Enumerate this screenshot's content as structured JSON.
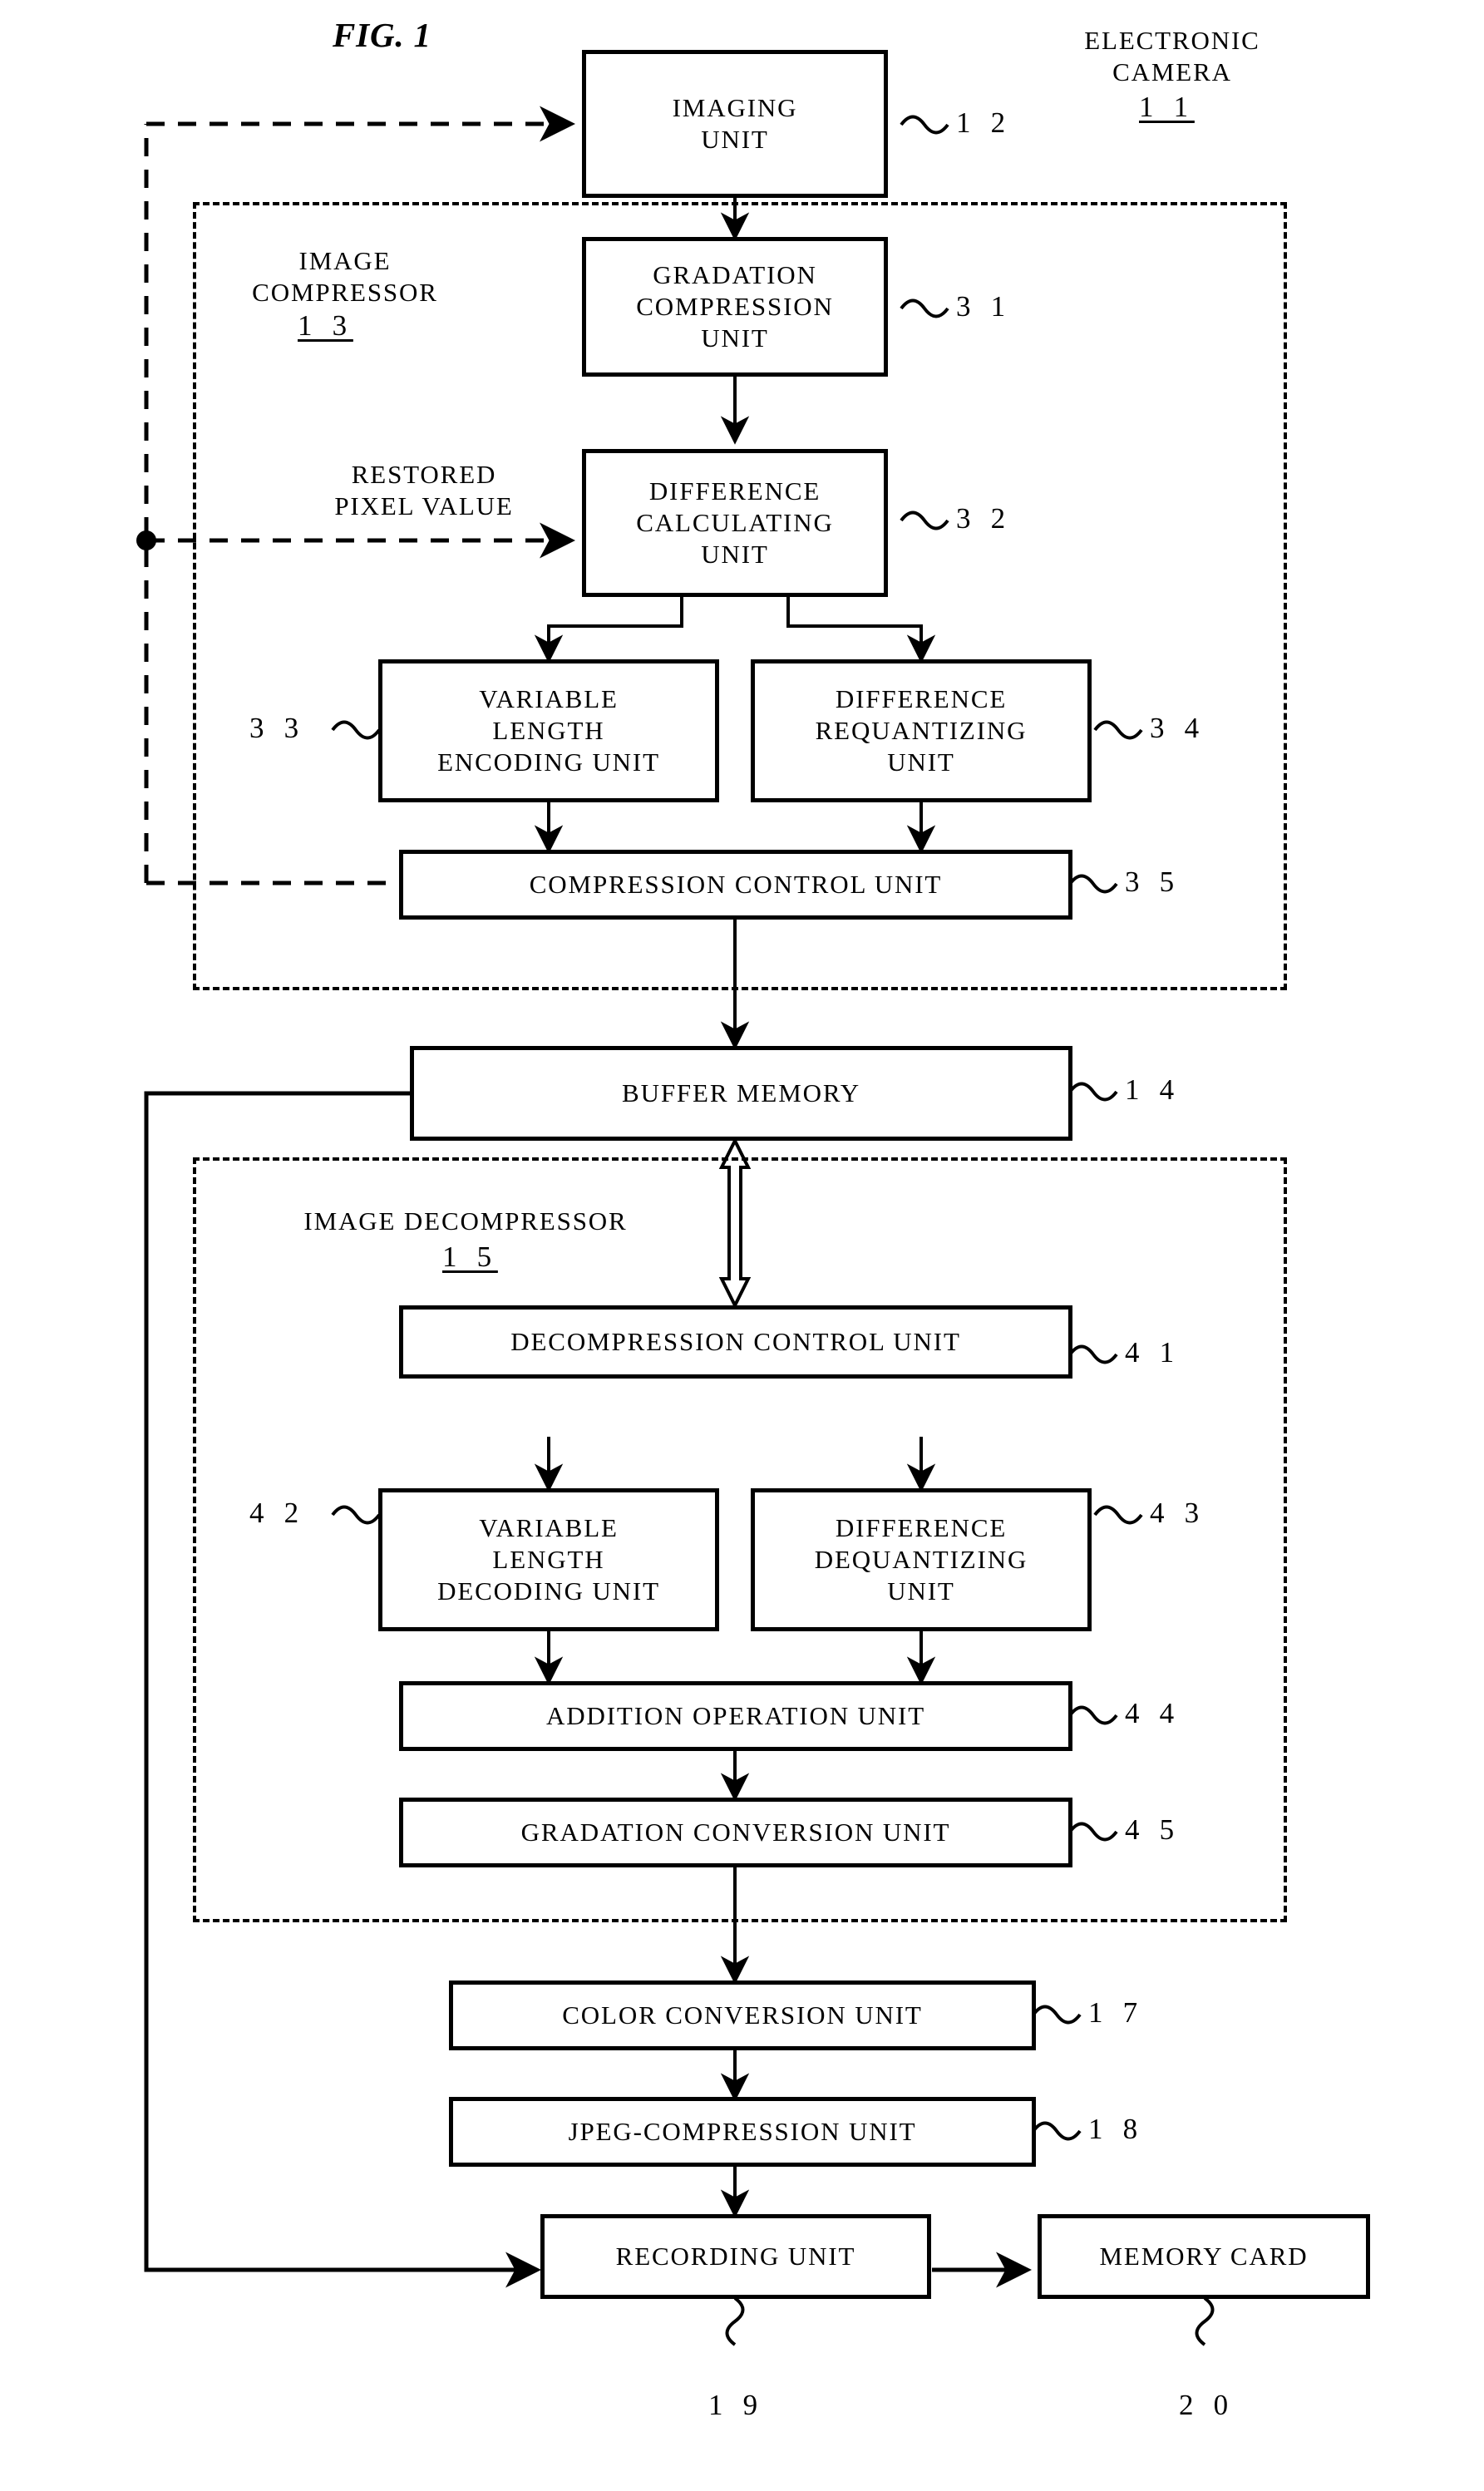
{
  "figure": {
    "title": "FIG. 1",
    "type": "patent-block-diagram"
  },
  "labels": {
    "electronic_camera": "ELECTRONIC\nCAMERA",
    "electronic_camera_ref": "1 1",
    "image_compressor": "IMAGE\nCOMPRESSOR",
    "image_compressor_ref": "1 3",
    "image_decompressor": "IMAGE DECOMPRESSOR",
    "image_decompressor_ref": "1 5",
    "restored_pixel_value": "RESTORED\nPIXEL VALUE"
  },
  "blocks": [
    {
      "id": "imaging_unit",
      "label": "IMAGING\nUNIT",
      "ref": "1 2"
    },
    {
      "id": "gradation_compression",
      "label": "GRADATION\nCOMPRESSION\nUNIT",
      "ref": "3 1"
    },
    {
      "id": "difference_calculating",
      "label": "DIFFERENCE\nCALCULATING\nUNIT",
      "ref": "3 2"
    },
    {
      "id": "variable_length_encoding",
      "label": "VARIABLE\nLENGTH\nENCODING UNIT",
      "ref": "3 3"
    },
    {
      "id": "difference_requantizing",
      "label": "DIFFERENCE\nREQUANTIZING\nUNIT",
      "ref": "3 4"
    },
    {
      "id": "compression_control",
      "label": "COMPRESSION CONTROL UNIT",
      "ref": "3 5"
    },
    {
      "id": "buffer_memory",
      "label": "BUFFER MEMORY",
      "ref": "1 4"
    },
    {
      "id": "decompression_control",
      "label": "DECOMPRESSION CONTROL UNIT",
      "ref": "4 1"
    },
    {
      "id": "variable_length_decoding",
      "label": "VARIABLE\nLENGTH\nDECODING UNIT",
      "ref": "4 2"
    },
    {
      "id": "difference_dequantizing",
      "label": "DIFFERENCE\nDEQUANTIZING\nUNIT",
      "ref": "4 3"
    },
    {
      "id": "addition_operation",
      "label": "ADDITION OPERATION UNIT",
      "ref": "4 4"
    },
    {
      "id": "gradation_conversion",
      "label": "GRADATION CONVERSION UNIT",
      "ref": "4 5"
    },
    {
      "id": "color_conversion",
      "label": "COLOR CONVERSION UNIT",
      "ref": "1 7"
    },
    {
      "id": "jpeg_compression",
      "label": "JPEG-COMPRESSION UNIT",
      "ref": "1 8"
    },
    {
      "id": "recording_unit",
      "label": "RECORDING UNIT",
      "ref": "1 9"
    },
    {
      "id": "memory_card",
      "label": "MEMORY CARD",
      "ref": "2 0"
    }
  ],
  "colors": {
    "ink": "#000000",
    "paper": "#ffffff"
  }
}
